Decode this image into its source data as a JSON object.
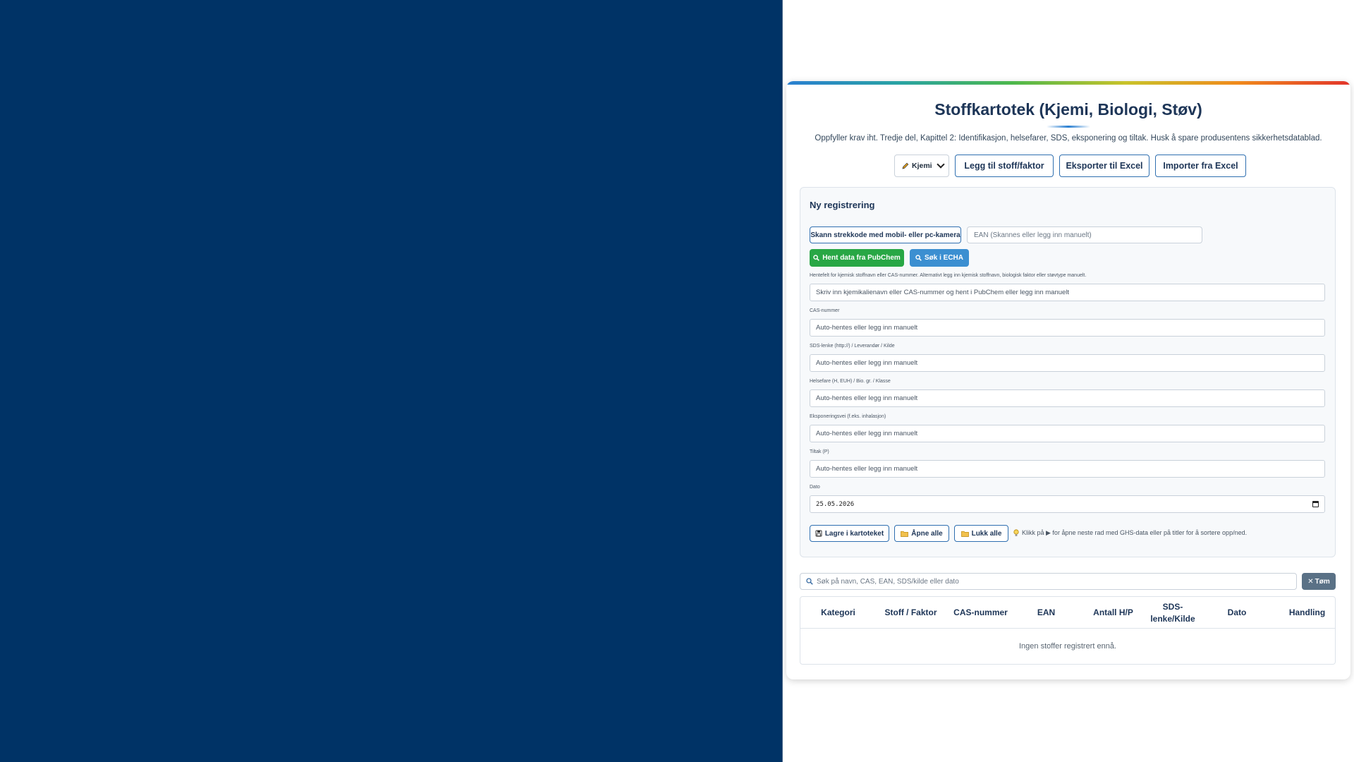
{
  "header": {
    "title": "Stoffkartotek (Kjemi, Biologi, Støv)",
    "subtitle": "Oppfyller krav iht. Tredje del, Kapittel 2: Identifikasjon, helsefarer, SDS, eksponering og tiltak. Husk å spare produsentens sikkerhetsdatablad."
  },
  "toolbar": {
    "category_selected": "Kjemi",
    "add_label": "Legg til stoff/faktor",
    "export_label": "Eksporter til Excel",
    "import_label": "Importer fra Excel"
  },
  "form": {
    "heading": "Ny registrering",
    "scan_label": "Skann strekkode med mobil- eller pc-kamera",
    "ean_placeholder": "EAN (Skannes eller legg inn manuelt)",
    "pubchem_label": "Hent data fra PubChem",
    "echa_label": "Søk i ECHA",
    "fields": [
      {
        "label": "Hentefelt for kjemisk stoffnavn eller CAS-nummer. Alternativt legg inn kjemisk stoffnavn, biologisk faktor eller støvtype manuelt.",
        "placeholder": "Skriv inn kjemikalienavn eller CAS-nummer og hent i PubChem eller legg inn manuelt"
      },
      {
        "label": "CAS-nummer",
        "placeholder": "Auto-hentes eller legg inn manuelt"
      },
      {
        "label": "SDS-lenke (http://) / Leverandør / Kilde",
        "placeholder": "Auto-hentes eller legg inn manuelt"
      },
      {
        "label": "Helsefare (H, EUH) / Bio. gr. / Klasse",
        "placeholder": "Auto-hentes eller legg inn manuelt"
      },
      {
        "label": "Eksponeringsvei (f.eks. inhalasjon)",
        "placeholder": "Auto-hentes eller legg inn manuelt"
      },
      {
        "label": "Tiltak (P)",
        "placeholder": "Auto-hentes eller legg inn manuelt"
      }
    ],
    "date_label": "Dato",
    "date_value": "25.05.2026",
    "save_label": "Lagre i kartoteket",
    "open_all_label": "Åpne alle",
    "close_all_label": "Lukk alle",
    "hint": "Klikk på ▶ for åpne neste rad med GHS-data eller på titler for å sortere opp/ned."
  },
  "search": {
    "placeholder": "Søk på navn, CAS, EAN, SDS/kilde eller dato",
    "clear_label": "Tøm"
  },
  "table": {
    "columns": [
      "Kategori",
      "Stoff / Faktor",
      "CAS-nummer",
      "EAN",
      "Antall H/P",
      "SDS-lenke/Kilde",
      "Dato",
      "Handling"
    ],
    "empty_text": "Ingen stoffer registrert ennå."
  },
  "colors": {
    "left_panel": "#003366",
    "accent_blue": "#2f6fb0",
    "pubchem_green": "#28a745",
    "echa_blue": "#3b8fd1",
    "clear_gray": "#5a7186"
  },
  "icons": {
    "category": "pencil-icon",
    "search": "magnifier-icon",
    "save": "floppy-disk-icon",
    "folder": "folder-icon",
    "hint": "lightbulb-icon",
    "clear": "x-icon",
    "date": "calendar-icon"
  }
}
